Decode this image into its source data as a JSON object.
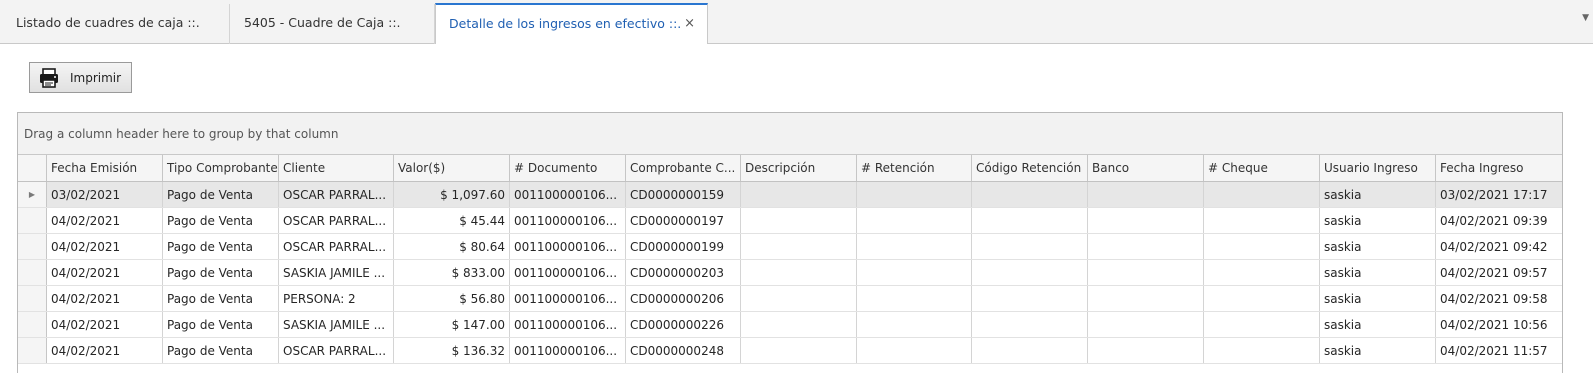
{
  "tabs": [
    {
      "label": "Listado de cuadres de caja ::."
    },
    {
      "label": "5405 - Cuadre de Caja ::."
    },
    {
      "label": "Detalle de los ingresos en efectivo ::.",
      "close": "×"
    }
  ],
  "toolbar": {
    "print_label": "Imprimir",
    "print_icon": "printer-icon"
  },
  "grid": {
    "group_panel_text": "Drag a column header here to group by that column",
    "columns": [
      "Fecha Emisión",
      "Tipo Comprobante",
      "Cliente",
      "Valor($)",
      "# Documento",
      "Comprobante C...",
      "Descripción",
      "# Retención",
      "Código Retención",
      "Banco",
      "# Cheque",
      "Usuario Ingreso",
      "Fecha Ingreso"
    ],
    "rows": [
      [
        "03/02/2021",
        "Pago de Venta",
        "OSCAR PARRAL...",
        "$ 1,097.60",
        "001100000106...",
        "CD0000000159",
        "",
        "",
        "",
        "",
        "",
        "saskia",
        "03/02/2021 17:17"
      ],
      [
        "04/02/2021",
        "Pago de Venta",
        "OSCAR PARRAL...",
        "$ 45.44",
        "001100000106...",
        "CD0000000197",
        "",
        "",
        "",
        "",
        "",
        "saskia",
        "04/02/2021 09:39"
      ],
      [
        "04/02/2021",
        "Pago de Venta",
        "OSCAR PARRAL...",
        "$ 80.64",
        "001100000106...",
        "CD0000000199",
        "",
        "",
        "",
        "",
        "",
        "saskia",
        "04/02/2021 09:42"
      ],
      [
        "04/02/2021",
        "Pago de Venta",
        "SASKIA JAMILE ...",
        "$ 833.00",
        "001100000106...",
        "CD0000000203",
        "",
        "",
        "",
        "",
        "",
        "saskia",
        "04/02/2021 09:57"
      ],
      [
        "04/02/2021",
        "Pago de Venta",
        "PERSONA: 2",
        "$ 56.80",
        "001100000106...",
        "CD0000000206",
        "",
        "",
        "",
        "",
        "",
        "saskia",
        "04/02/2021 09:58"
      ],
      [
        "04/02/2021",
        "Pago de Venta",
        "SASKIA JAMILE ...",
        "$ 147.00",
        "001100000106...",
        "CD0000000226",
        "",
        "",
        "",
        "",
        "",
        "saskia",
        "04/02/2021 10:56"
      ],
      [
        "04/02/2021",
        "Pago de Venta",
        "OSCAR PARRAL...",
        "$ 136.32",
        "001100000106...",
        "CD0000000248",
        "",
        "",
        "",
        "",
        "",
        "saskia",
        "04/02/2021 11:57"
      ]
    ]
  }
}
